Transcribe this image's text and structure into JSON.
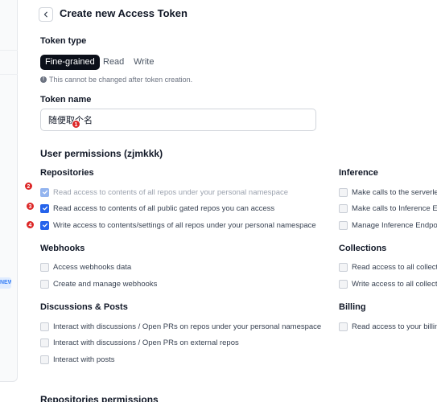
{
  "header": {
    "title": "Create new Access Token"
  },
  "sidebar": {
    "badge": "NEW"
  },
  "token_type": {
    "label": "Token type",
    "tabs": [
      "Fine-grained",
      "Read",
      "Write"
    ],
    "selected": "Fine-grained",
    "notice": "This cannot be changed after token creation."
  },
  "token_name": {
    "label": "Token name",
    "value": "随便取个名"
  },
  "user_permissions": {
    "title": "User permissions (zjmkkk)"
  },
  "repositories": {
    "title": "Repositories",
    "items": [
      {
        "label": "Read access to contents of all repos under your personal namespace",
        "checked": true,
        "disabled": true
      },
      {
        "label": "Read access to contents of all public gated repos you can access",
        "checked": true,
        "disabled": false
      },
      {
        "label": "Write access to contents/settings of all repos under your personal namespace",
        "checked": true,
        "disabled": false
      }
    ]
  },
  "webhooks": {
    "title": "Webhooks",
    "items": [
      {
        "label": "Access webhooks data",
        "checked": false
      },
      {
        "label": "Create and manage webhooks",
        "checked": false
      }
    ]
  },
  "discussions": {
    "title": "Discussions & Posts",
    "items": [
      {
        "label": "Interact with discussions / Open PRs on repos under your personal namespace",
        "checked": false
      },
      {
        "label": "Interact with discussions / Open PRs on external repos",
        "checked": false
      },
      {
        "label": "Interact with posts",
        "checked": false
      }
    ]
  },
  "inference": {
    "title": "Inference",
    "items": [
      {
        "label": "Make calls to the serverle",
        "checked": false
      },
      {
        "label": "Make calls to Inference En",
        "checked": false
      },
      {
        "label": "Manage Inference Endpoi",
        "checked": false
      }
    ]
  },
  "collections": {
    "title": "Collections",
    "items": [
      {
        "label": "Read access to all collecti",
        "checked": false
      },
      {
        "label": "Write access to all collecti",
        "checked": false
      }
    ]
  },
  "billing": {
    "title": "Billing",
    "items": [
      {
        "label": "Read access to your billin",
        "checked": false
      }
    ]
  },
  "repositories_permissions": {
    "title": "Repositories permissions"
  },
  "markers": [
    "1",
    "2",
    "3",
    "4"
  ],
  "colors": {
    "accent": "#2563eb",
    "active_tab": "#0b0f19",
    "marker": "#dc2626"
  }
}
